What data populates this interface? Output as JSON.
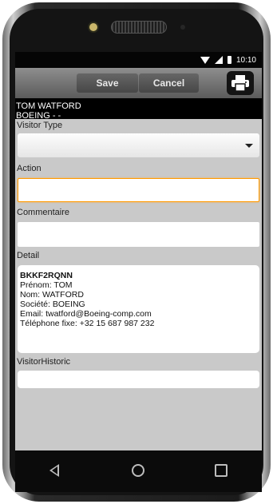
{
  "status_bar": {
    "time": "10:10"
  },
  "toolbar": {
    "save_label": "Save",
    "cancel_label": "Cancel",
    "print_icon": "printer-icon"
  },
  "visitor": {
    "name": "TOM WATFORD",
    "company_line": "BOEING -  -"
  },
  "form": {
    "visitor_type": {
      "label": "Visitor Type",
      "value": ""
    },
    "action": {
      "label": "Action",
      "value": ""
    },
    "commentaire": {
      "label": "Commentaire",
      "value": ""
    },
    "detail": {
      "label": "Detail",
      "code": "BKKF2RQNN",
      "lines": [
        "Prénom: TOM",
        "Nom: WATFORD",
        "Société: BOEING",
        "Email: twatford@Boeing-comp.com",
        "Téléphone fixe: +32 15 687 987 232"
      ]
    },
    "historic": {
      "label": "VisitorHistoric",
      "value": ""
    }
  },
  "colors": {
    "accent_focus": "#ff9900",
    "toolbar": "#6f6f6f",
    "background": "#c9c9c9"
  }
}
